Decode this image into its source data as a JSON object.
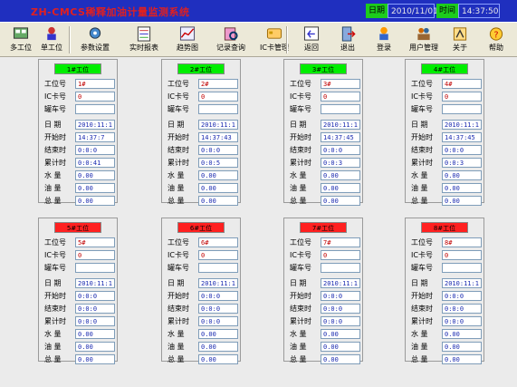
{
  "header": {
    "title": "ZH-CMCS稀释加油计量监测系统",
    "date_label": "日期",
    "date_value": "2010/11/01",
    "time_label": "时间",
    "time_value": "14:37:50"
  },
  "toolbar": [
    {
      "label": "多工位",
      "icon": "multi-station-icon"
    },
    {
      "label": "单工位",
      "icon": "single-station-icon"
    },
    {
      "label": "参数设置",
      "icon": "settings-icon"
    },
    {
      "label": "实时报表",
      "icon": "report-icon"
    },
    {
      "label": "趋势图",
      "icon": "trend-chart-icon"
    },
    {
      "label": "记录查询",
      "icon": "record-query-icon"
    },
    {
      "label": "IC卡管理",
      "icon": "ic-card-icon"
    },
    {
      "label": "返回",
      "icon": "back-icon"
    },
    {
      "label": "退出",
      "icon": "exit-icon"
    },
    {
      "label": "登录",
      "icon": "login-icon"
    },
    {
      "label": "用户管理",
      "icon": "user-manage-icon"
    },
    {
      "label": "关于",
      "icon": "about-icon"
    },
    {
      "label": "帮助",
      "icon": "help-icon"
    }
  ],
  "field_labels": [
    "工位号",
    "IC卡号",
    "罐车号",
    "日 期",
    "开始时",
    "结束时",
    "累计时",
    "水 量",
    "油 量",
    "总 量"
  ],
  "colors": {
    "active": "#00ee00",
    "inactive": "#ff2020"
  },
  "stations": [
    {
      "name": "1#工位",
      "status": "active",
      "values": [
        "1#",
        "0",
        "",
        "2010:11:1",
        "14:37:7",
        "0:0:0",
        "0:0:41",
        "0.00",
        "0.00",
        "0.00"
      ]
    },
    {
      "name": "2#工位",
      "status": "active",
      "values": [
        "2#",
        "0",
        "",
        "2010:11:1",
        "14:37:43",
        "0:0:0",
        "0:0:5",
        "0.00",
        "0.00",
        "0.00"
      ]
    },
    {
      "name": "3#工位",
      "status": "active",
      "values": [
        "3#",
        "0",
        "",
        "2010:11:1",
        "14:37:45",
        "0:0:0",
        "0:0:3",
        "0.00",
        "0.00",
        "0.00"
      ]
    },
    {
      "name": "4#工位",
      "status": "active",
      "values": [
        "4#",
        "0",
        "",
        "2010:11:1",
        "14:37:45",
        "0:0:0",
        "0:0:3",
        "0.00",
        "0.00",
        "0.00"
      ]
    },
    {
      "name": "5#工位",
      "status": "inactive",
      "values": [
        "5#",
        "0",
        "",
        "2010:11:1",
        "0:0:0",
        "0:0:0",
        "0:0:0",
        "0.00",
        "0.00",
        "0.00"
      ]
    },
    {
      "name": "6#工位",
      "status": "inactive",
      "values": [
        "6#",
        "0",
        "",
        "2010:11:1",
        "0:0:0",
        "0:0:0",
        "0:0:0",
        "0.00",
        "0.00",
        "0.00"
      ]
    },
    {
      "name": "7#工位",
      "status": "inactive",
      "values": [
        "7#",
        "0",
        "",
        "2010:11:1",
        "0:0:0",
        "0:0:0",
        "0:0:0",
        "0.00",
        "0.00",
        "0.00"
      ]
    },
    {
      "name": "8#工位",
      "status": "inactive",
      "values": [
        "8#",
        "0",
        "",
        "2010:11:1",
        "0:0:0",
        "0:0:0",
        "0:0:0",
        "0.00",
        "0.00",
        "0.00"
      ]
    }
  ]
}
